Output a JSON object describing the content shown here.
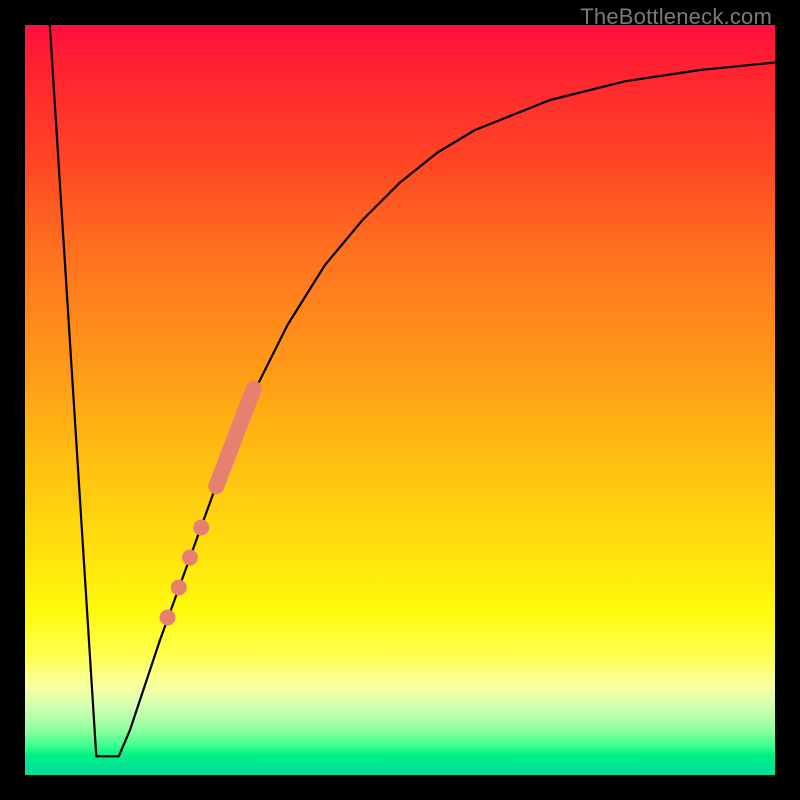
{
  "watermark": "TheBottleneck.com",
  "chart_data": {
    "type": "line",
    "title": "",
    "xlabel": "",
    "ylabel": "",
    "xlim": [
      0,
      100
    ],
    "ylim": [
      0,
      100
    ],
    "grid": false,
    "legend": false,
    "series": [
      {
        "name": "bottleneck-curve",
        "points": [
          {
            "x": 3.3,
            "y": 100
          },
          {
            "x": 9.5,
            "y": 2.5
          },
          {
            "x": 12.5,
            "y": 2.5
          },
          {
            "x": 14,
            "y": 6
          },
          {
            "x": 18,
            "y": 18
          },
          {
            "x": 22,
            "y": 29
          },
          {
            "x": 26,
            "y": 40
          },
          {
            "x": 30,
            "y": 50
          },
          {
            "x": 35,
            "y": 60
          },
          {
            "x": 40,
            "y": 68
          },
          {
            "x": 45,
            "y": 74
          },
          {
            "x": 50,
            "y": 79
          },
          {
            "x": 55,
            "y": 83
          },
          {
            "x": 60,
            "y": 86
          },
          {
            "x": 70,
            "y": 90
          },
          {
            "x": 80,
            "y": 92.5
          },
          {
            "x": 90,
            "y": 94
          },
          {
            "x": 100,
            "y": 95
          }
        ]
      }
    ],
    "markers": [
      {
        "name": "thick-segment",
        "type": "line-thick",
        "color": "#e88070",
        "points": [
          {
            "x": 25.5,
            "y": 38.5
          },
          {
            "x": 30.5,
            "y": 51.5
          }
        ]
      },
      {
        "name": "dot-1",
        "type": "dot",
        "color": "#e88070",
        "x": 22.0,
        "y": 29.0
      },
      {
        "name": "dot-2",
        "type": "dot",
        "color": "#e88070",
        "x": 23.5,
        "y": 33.0
      },
      {
        "name": "dot-3",
        "type": "dot",
        "color": "#e88070",
        "x": 20.5,
        "y": 25.0
      },
      {
        "name": "dot-4",
        "type": "dot",
        "color": "#e88070",
        "x": 19.0,
        "y": 21.0
      }
    ]
  }
}
